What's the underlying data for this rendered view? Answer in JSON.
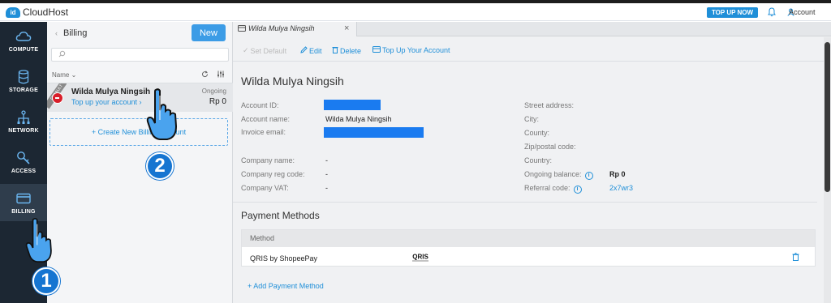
{
  "topbar": {
    "logo_mark": "id",
    "logo_text": "CloudHost",
    "topup_label": "TOP UP NOW",
    "account_label": "Account"
  },
  "nav": [
    {
      "label": "COMPUTE",
      "icon": "cloud-icon"
    },
    {
      "label": "STORAGE",
      "icon": "database-icon"
    },
    {
      "label": "NETWORK",
      "icon": "network-icon"
    },
    {
      "label": "ACCESS",
      "icon": "key-icon"
    },
    {
      "label": "BILLING",
      "icon": "credit-card-icon",
      "active": true
    }
  ],
  "billing_panel": {
    "title": "Billing",
    "new_label": "New",
    "search_placeholder": "",
    "sort_label": "Name ⌄",
    "items": [
      {
        "ribbon": "DEFAULT",
        "name": "Wilda Mulya Ningsih",
        "link": "Top up your account ›",
        "status": "Ongoing",
        "balance": "Rp 0"
      }
    ],
    "create_label": "+ Create New Billing Account"
  },
  "main": {
    "tab_label": "Wilda Mulya Ningsih",
    "actions": {
      "set_default": "Set Default",
      "edit": "Edit",
      "delete": "Delete",
      "top_up": "Top Up Your Account"
    },
    "title": "Wilda Mulya Ningsih",
    "left_fields": {
      "account_id_label": "Account ID:",
      "account_name_label": "Account name:",
      "account_name_value": "Wilda Mulya Ningsih",
      "invoice_email_label": "Invoice email:",
      "company_name_label": "Company name:",
      "company_name_value": "-",
      "company_reg_label": "Company reg code:",
      "company_reg_value": "-",
      "company_vat_label": "Company VAT:",
      "company_vat_value": "-"
    },
    "right_fields": {
      "street_label": "Street address:",
      "city_label": "City:",
      "county_label": "County:",
      "zip_label": "Zip/postal code:",
      "country_label": "Country:",
      "balance_label": "Ongoing balance:",
      "balance_value": "Rp 0",
      "referral_label": "Referral code:",
      "referral_value": "2x7wr3"
    },
    "payment_methods": {
      "title": "Payment Methods",
      "column": "Method",
      "rows": [
        {
          "name": "QRIS by ShopeePay",
          "logo_text": "QRIS"
        }
      ],
      "add_label": "+ Add Payment Method"
    }
  },
  "annotations": {
    "step1": "1",
    "step2": "2"
  },
  "colors": {
    "accent": "#1f8fd8",
    "nav_bg": "#1c2733",
    "redaction": "#1a7bf0"
  }
}
